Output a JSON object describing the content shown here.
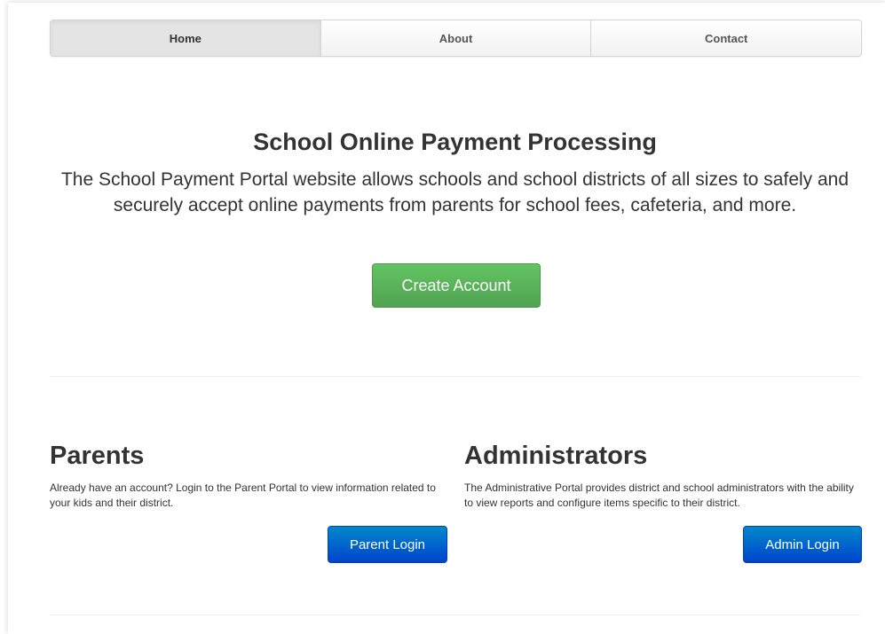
{
  "nav": {
    "items": [
      {
        "label": "Home",
        "active": true
      },
      {
        "label": "About",
        "active": false
      },
      {
        "label": "Contact",
        "active": false
      }
    ]
  },
  "hero": {
    "title": "School Online Payment Processing",
    "description": "The School Payment Portal website allows schools and school districts of all sizes to safely and securely accept online payments from parents for school fees, cafeteria, and more.",
    "cta_label": "Create Account"
  },
  "parents": {
    "heading": "Parents",
    "text": "Already have an account? Login to the Parent Portal to view information related to your kids and their district.",
    "button_label": "Parent Login"
  },
  "administrators": {
    "heading": "Administrators",
    "text": "The Administrative Portal provides district and school administrators with the ability to view reports and configure items specific to their district.",
    "button_label": "Admin Login"
  },
  "colors": {
    "success": "#5bb75b",
    "primary": "#0066cc",
    "text": "#333333"
  }
}
